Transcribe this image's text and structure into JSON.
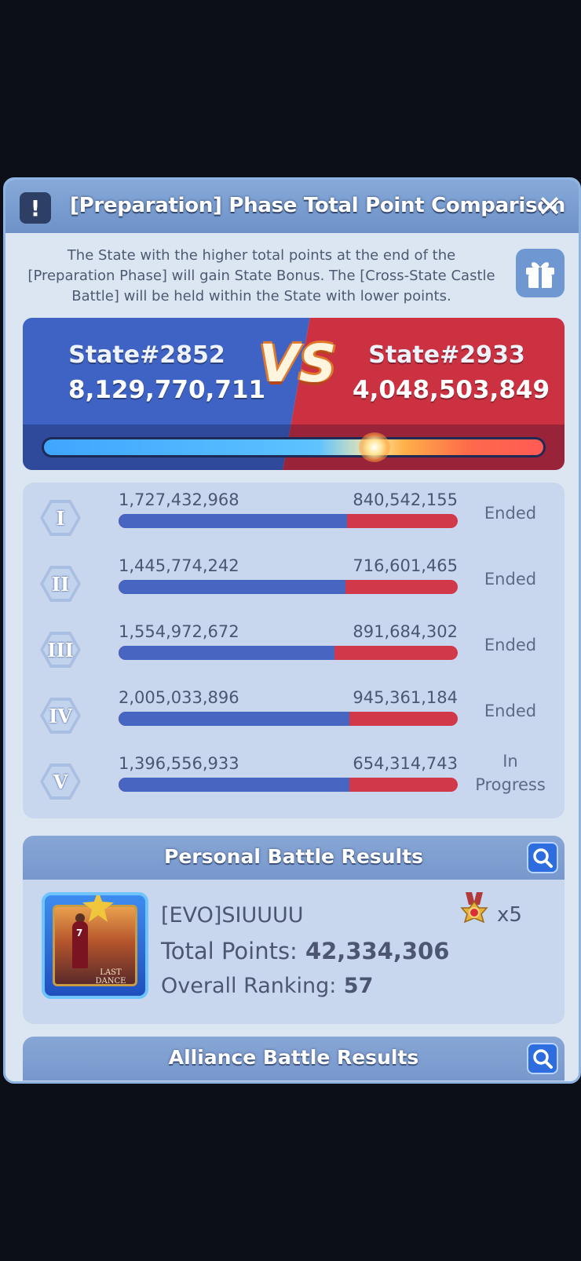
{
  "header": {
    "title": "[Preparation] Phase Total Point Comparison"
  },
  "description": "The State with the higher total points at the end of the [Preparation Phase] will gain State Bonus. The [Cross-State Castle Battle] will be held within the State with lower points.",
  "comparison": {
    "left": {
      "state": "State#2852",
      "points": "8,129,770,711"
    },
    "vs": "VS",
    "right": {
      "state": "State#2933",
      "points": "4,048,503,849"
    },
    "left_share": 0.668
  },
  "phases": [
    {
      "numeral": "I",
      "left": "1,727,432,968",
      "right": "840,542,155",
      "left_share": 0.673,
      "status": "Ended"
    },
    {
      "numeral": "II",
      "left": "1,445,774,242",
      "right": "716,601,465",
      "left_share": 0.669,
      "status": "Ended"
    },
    {
      "numeral": "III",
      "left": "1,554,972,672",
      "right": "891,684,302",
      "left_share": 0.636,
      "status": "Ended"
    },
    {
      "numeral": "IV",
      "left": "2,005,033,896",
      "right": "945,361,184",
      "left_share": 0.68,
      "status": "Ended"
    },
    {
      "numeral": "V",
      "left": "1,396,556,933",
      "right": "654,314,743",
      "left_share": 0.681,
      "status": "In Progress"
    }
  ],
  "personal": {
    "title": "Personal Battle Results",
    "player_name": "[EVO]SIUUUU",
    "total_points_label": "Total Points:",
    "total_points": "42,334,306",
    "ranking_label": "Overall Ranking:",
    "ranking": "57",
    "medal_count": "x5",
    "avatar_jersey": "7",
    "avatar_caption": "LAST DANCE"
  },
  "alliance": {
    "title": "Alliance Battle Results"
  },
  "icons": {
    "info": "exclamation-icon",
    "close": "close-icon",
    "gift": "gift-icon",
    "search": "magnifier-icon",
    "medal": "medal-icon"
  },
  "colors": {
    "blue_team": "#3f63c4",
    "red_team": "#cc3142",
    "panel": "#dce6f3"
  }
}
